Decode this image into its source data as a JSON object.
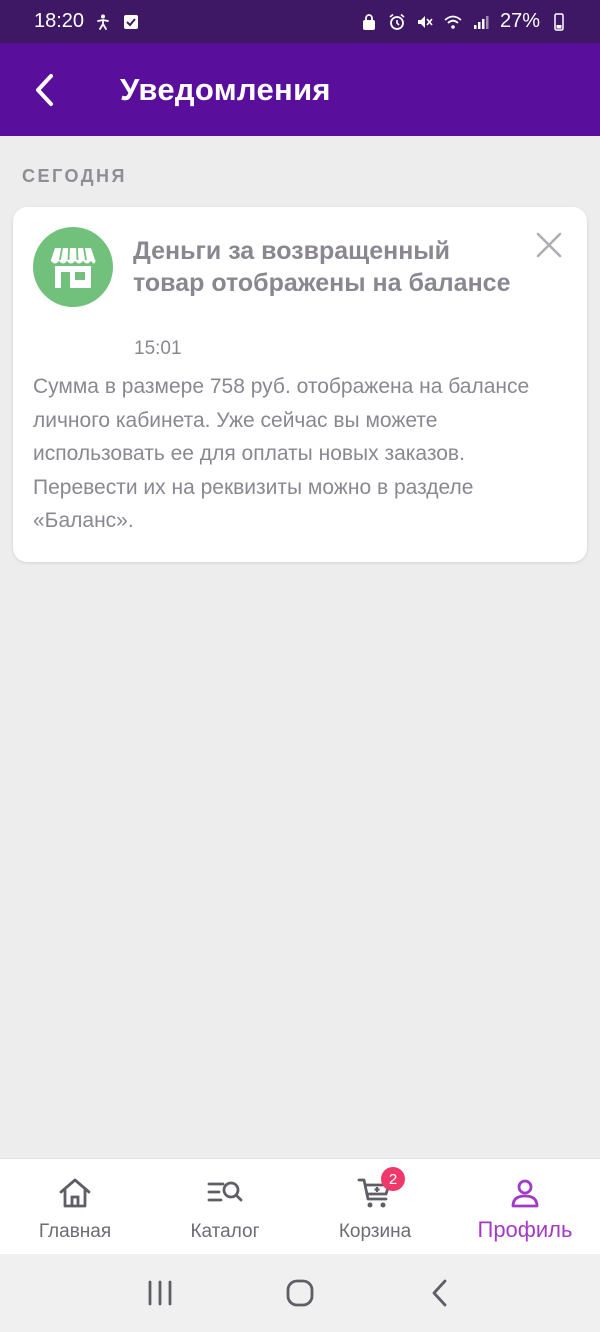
{
  "status_bar": {
    "time": "18:20",
    "battery": "27%",
    "left_icons": [
      "accessibility-icon",
      "checkbox-icon"
    ],
    "right_icons": [
      "lock-icon",
      "alarm-icon",
      "mute-icon",
      "wifi-icon",
      "signal-icon",
      "battery-icon"
    ]
  },
  "app_bar": {
    "title": "Уведомления",
    "back_icon": "chevron-left-icon",
    "background": "#5a0f9c"
  },
  "section": {
    "label": "СЕГОДНЯ"
  },
  "notification": {
    "icon": "store-icon",
    "icon_color": "#71c07b",
    "title": "Деньги за возвращенный товар отображены на балансе",
    "time": "15:01",
    "body": "Сумма в размере 758 руб. отображена на балансе личного кабинета. Уже сейчас вы можете использовать ее для оплаты новых заказов. Перевести их на реквизиты можно в разделе «Баланс».",
    "close_icon": "close-icon"
  },
  "tab_bar": {
    "active_color": "#a13ac6",
    "tabs": [
      {
        "label": "Главная",
        "icon": "home-icon",
        "active": false
      },
      {
        "label": "Каталог",
        "icon": "catalog-search-icon",
        "active": false
      },
      {
        "label": "Корзина",
        "icon": "cart-icon",
        "active": false,
        "badge": "2"
      },
      {
        "label": "Профиль",
        "icon": "profile-icon",
        "active": true
      }
    ]
  },
  "nav_bar": {
    "buttons": [
      "recents-icon",
      "home-button-icon",
      "back-icon"
    ]
  }
}
